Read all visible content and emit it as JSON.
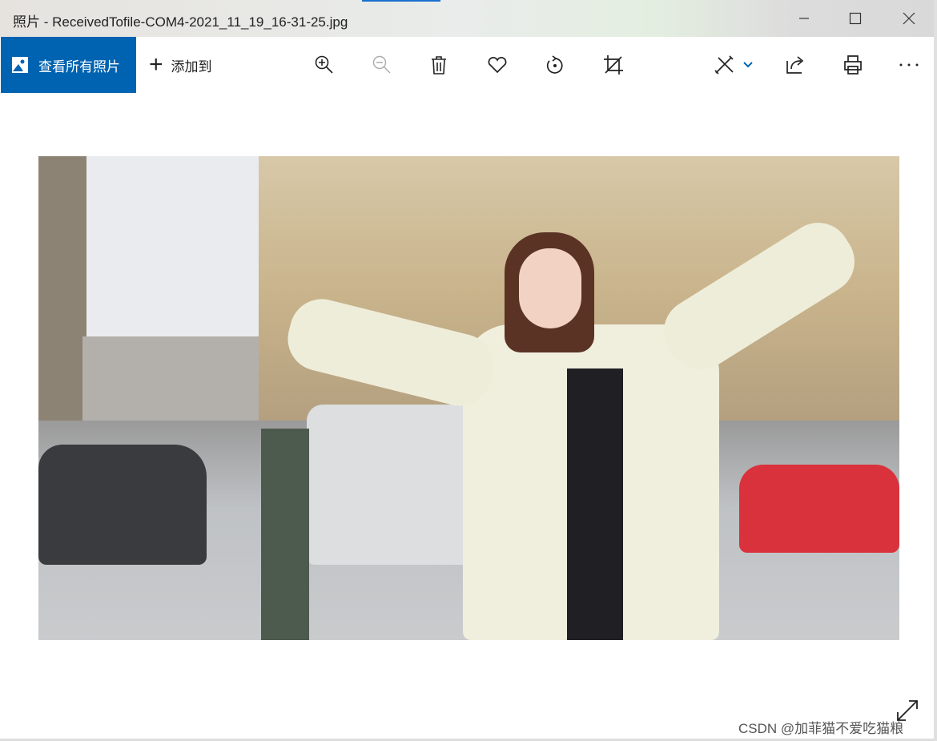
{
  "window": {
    "title": "照片 - ReceivedTofile-COM4-2021_11_19_16-31-25.jpg"
  },
  "toolbar": {
    "view_all_label": "查看所有照片",
    "add_to_label": "添加到",
    "accent": "#0063b1",
    "icons": [
      "zoom-in-icon",
      "zoom-out-icon",
      "delete-icon",
      "favorite-icon",
      "rotate-icon",
      "crop-icon",
      "edit-create-icon",
      "share-icon",
      "print-icon",
      "more-icon"
    ]
  },
  "watermark": "CSDN @加菲猫不爱吃猫粮"
}
